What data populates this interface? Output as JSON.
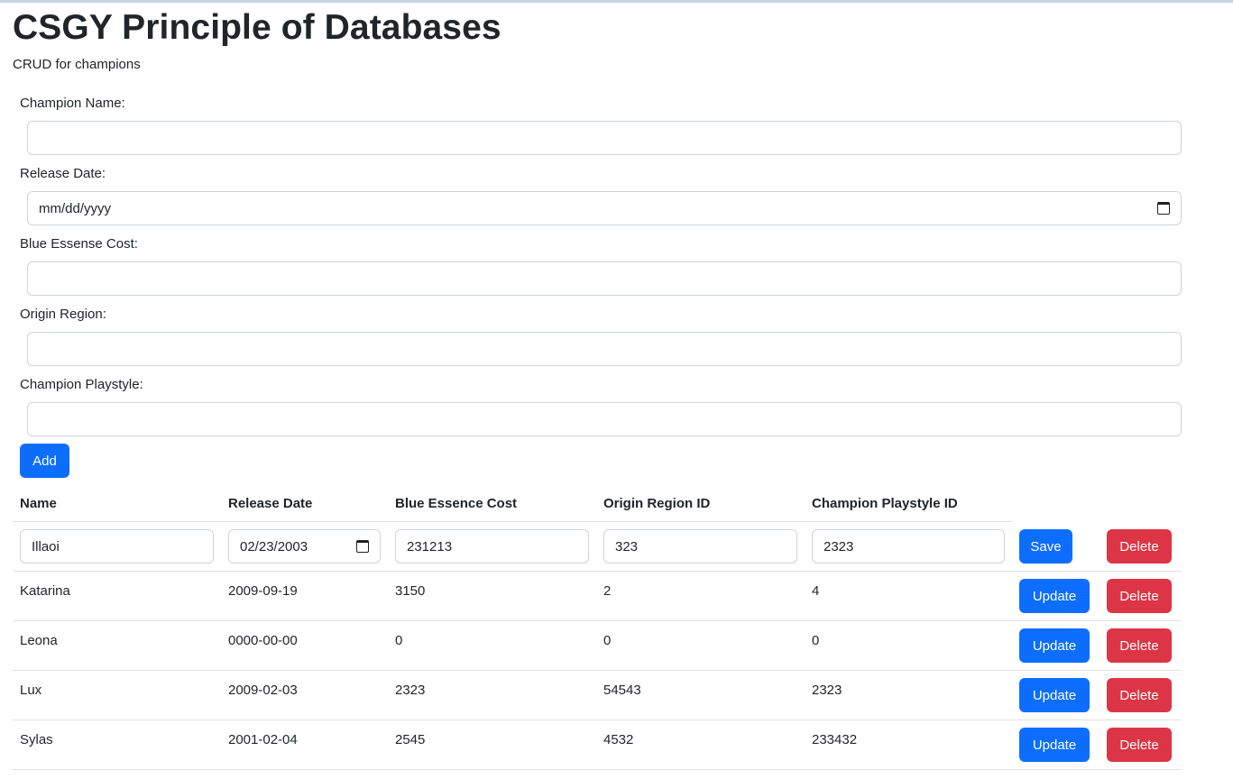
{
  "header": {
    "title": "CSGY Principle of Databases",
    "subtitle": "CRUD for champions"
  },
  "form": {
    "name_label": "Champion Name:",
    "name_value": "",
    "date_label": "Release Date:",
    "date_placeholder": "mm/dd/yyyy",
    "cost_label": "Blue Essense Cost:",
    "cost_value": "",
    "region_label": "Origin Region:",
    "region_value": "",
    "playstyle_label": "Champion Playstyle:",
    "playstyle_value": "",
    "add_label": "Add"
  },
  "table": {
    "headers": [
      "Name",
      "Release Date",
      "Blue Essence Cost",
      "Origin Region ID",
      "Champion Playstyle ID"
    ],
    "edit_row": {
      "name": "Illaoi",
      "release_date": "02/23/2003",
      "cost": "231213",
      "region": "323",
      "playstyle": "2323",
      "save_label": "Save",
      "delete_label": "Delete"
    },
    "rows": [
      {
        "name": "Katarina",
        "release_date": "2009-09-19",
        "cost": "3150",
        "region": "2",
        "playstyle": "4",
        "update_label": "Update",
        "delete_label": "Delete"
      },
      {
        "name": "Leona",
        "release_date": "0000-00-00",
        "cost": "0",
        "region": "0",
        "playstyle": "0",
        "update_label": "Update",
        "delete_label": "Delete"
      },
      {
        "name": "Lux",
        "release_date": "2009-02-03",
        "cost": "2323",
        "region": "54543",
        "playstyle": "2323",
        "update_label": "Update",
        "delete_label": "Delete"
      },
      {
        "name": "Sylas",
        "release_date": "2001-02-04",
        "cost": "2545",
        "region": "4532",
        "playstyle": "233432",
        "update_label": "Update",
        "delete_label": "Delete"
      }
    ]
  },
  "colors": {
    "primary": "#0d6efd",
    "danger": "#dc3545",
    "border": "#dee2e6"
  }
}
